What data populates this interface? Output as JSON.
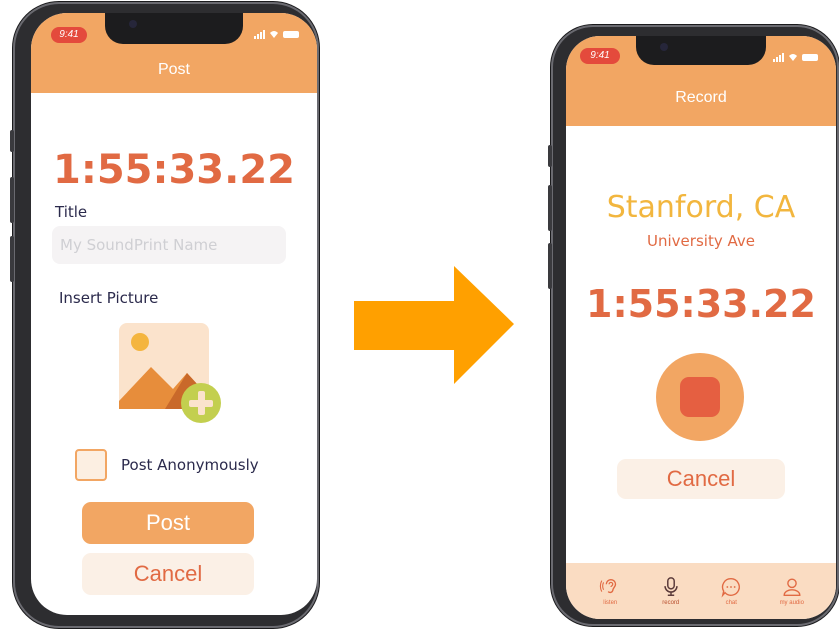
{
  "colors": {
    "accent_orange": "#f2a663",
    "timer_red": "#e16a43",
    "city_yellow": "#f2b63e",
    "record_red": "#e55f41",
    "arrow_orange": "#ffa000"
  },
  "left_screen": {
    "status_time": "9:41",
    "header_title": "Post",
    "timer": "1:55:33.22",
    "title_label": "Title",
    "title_placeholder": "My SoundPrint Name",
    "insert_picture_label": "Insert Picture",
    "picture_icon": "add-image-icon",
    "anonymous_label": "Post Anonymously",
    "anonymous_checked": false,
    "post_button": "Post",
    "cancel_button": "Cancel"
  },
  "right_screen": {
    "status_time": "9:41",
    "header_title": "Record",
    "city": "Stanford, CA",
    "street": "University Ave",
    "timer": "1:55:33.22",
    "record_icon": "stop-record-icon",
    "cancel_button": "Cancel",
    "tabs": [
      {
        "label": "listen",
        "icon": "ear-icon"
      },
      {
        "label": "record",
        "icon": "microphone-icon"
      },
      {
        "label": "chat",
        "icon": "chat-bubble-icon"
      },
      {
        "label": "my audio",
        "icon": "user-icon"
      }
    ]
  }
}
